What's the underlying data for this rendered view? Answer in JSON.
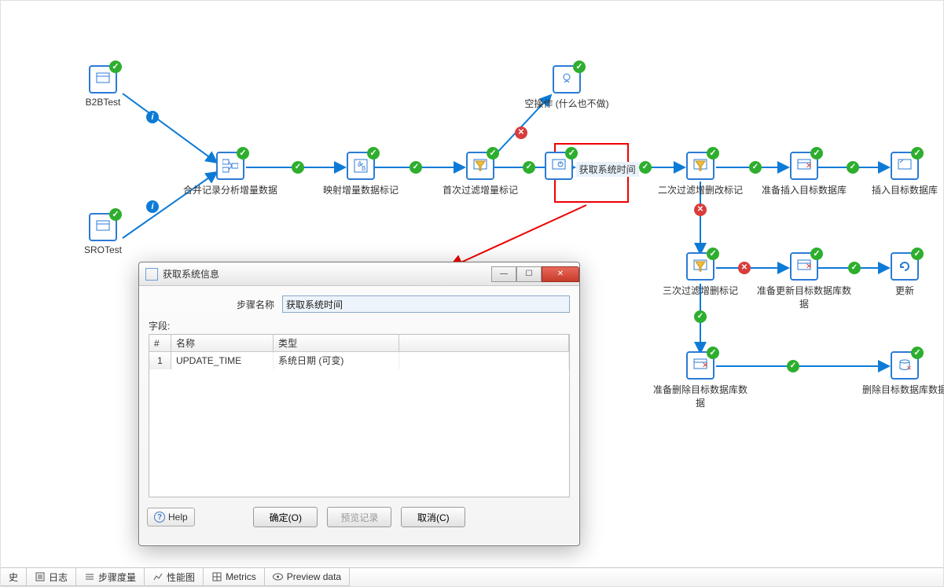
{
  "nodes": {
    "b2btest": {
      "label": "B2BTest"
    },
    "srotest": {
      "label": "SROTest"
    },
    "merge": {
      "label": "合并记录分析增量数据"
    },
    "map": {
      "label": "映射增量数据标记"
    },
    "first": {
      "label": "首次过滤增量标记"
    },
    "getsys": {
      "label": "获取系统时间"
    },
    "noop": {
      "label": "空操作 (什么也不做)"
    },
    "second": {
      "label": "二次过滤增删改标记"
    },
    "prepIns": {
      "label": "准备插入目标数据库"
    },
    "insert": {
      "label": "插入目标数据库"
    },
    "third": {
      "label": "三次过滤增删标记"
    },
    "prepUpd": {
      "label": "准备更新目标数据库数据"
    },
    "update": {
      "label": "更新"
    },
    "prepDel": {
      "label": "准备删除目标数据库数据"
    },
    "delete": {
      "label": "删除目标数据库数据"
    }
  },
  "dialog": {
    "title": "获取系统信息",
    "stepNameLabel": "步骤名称",
    "stepNameValue": "获取系统时间",
    "fieldsLabel": "字段:",
    "columns": {
      "idx": "#",
      "name": "名称",
      "type": "类型"
    },
    "rows": [
      {
        "idx": "1",
        "name": "UPDATE_TIME",
        "type": "系统日期 (可变)"
      }
    ],
    "help": "Help",
    "ok": "确定(O)",
    "preview": "预览记录",
    "cancel": "取消(C)"
  },
  "tabs": {
    "t1": "史",
    "t2": "日志",
    "t3": "步骤度量",
    "t4": "性能图",
    "t5": "Metrics",
    "t6": "Preview data"
  },
  "glyphs": {
    "check": "✓",
    "x": "✕",
    "i": "i",
    "min": "—",
    "max": "☐",
    "close": "✕"
  }
}
